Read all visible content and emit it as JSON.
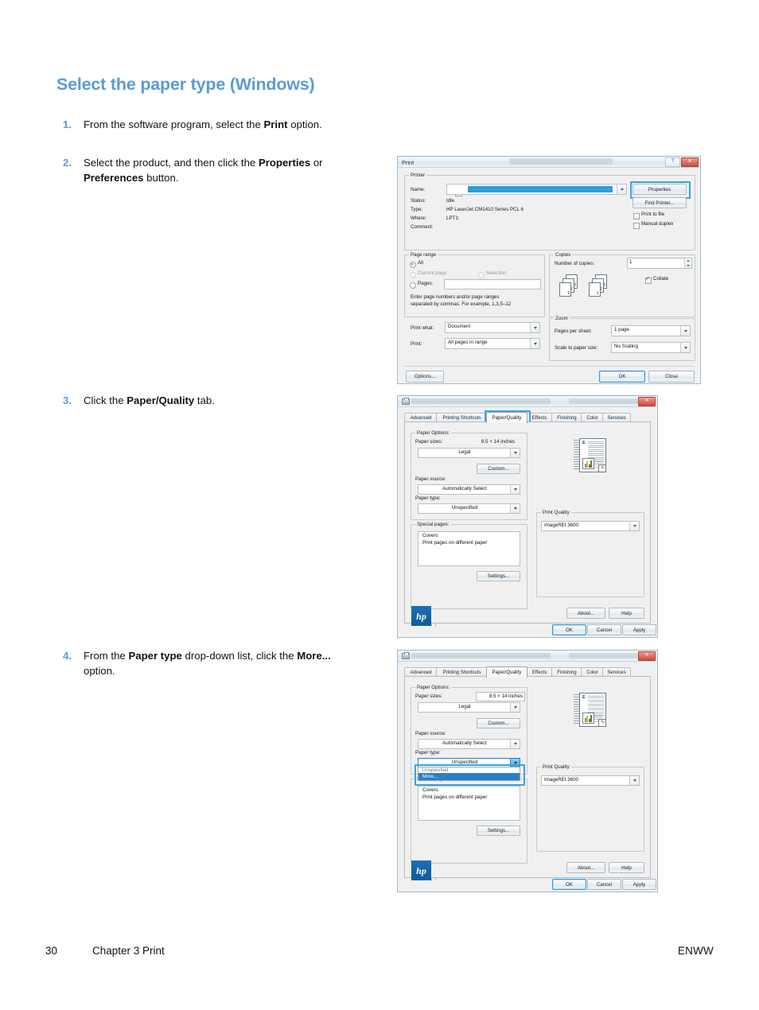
{
  "document": {
    "title": "Select the paper type (Windows)",
    "steps": [
      {
        "num": "1.",
        "text_html": "From the software program, select the <b>Print</b> option."
      },
      {
        "num": "2.",
        "text_html": "Select the product, and then click the <b>Properties</b> or <b>Preferences</b> button."
      },
      {
        "num": "3.",
        "text_html": "Click the <b>Paper/Quality</b> tab."
      },
      {
        "num": "4.",
        "text_html": "From the <b>Paper type</b> drop-down list, click the <b>More...</b> option."
      }
    ],
    "footer": {
      "page_number": "30",
      "chapter": "Chapter 3   Print",
      "right": "ENWW"
    },
    "accent_color": "#5b9bd5"
  },
  "print_dialog": {
    "title": "Print",
    "window_buttons": {
      "help": "?",
      "close": "✕"
    },
    "printer_group": {
      "label": "Printer",
      "name_label": "Name:",
      "name_value": "",
      "status_label": "Status:",
      "status_value": "Idle",
      "type_label": "Type:",
      "type_value": "HP LaserJet CM1410 Series PCL 6",
      "where_label": "Where:",
      "where_value": "LPT1:",
      "comment_label": "Comment:",
      "comment_value": "",
      "properties_button": "Properties",
      "find_printer_button": "Find Printer...",
      "print_to_file": {
        "label": "Print to file",
        "checked": false
      },
      "manual_duplex": {
        "label": "Manual duplex",
        "checked": false
      }
    },
    "page_range_group": {
      "label": "Page range",
      "all": {
        "label": "All",
        "selected": true
      },
      "current_page": {
        "label": "Current page",
        "selected": false,
        "disabled": true
      },
      "selection": {
        "label": "Selection",
        "selected": false,
        "disabled": true
      },
      "pages": {
        "label": "Pages:",
        "selected": false,
        "value": ""
      },
      "hint_line1": "Enter page numbers and/or page ranges",
      "hint_line2": "separated by commas.  For example, 1,3,5–12"
    },
    "print_what_label": "Print what:",
    "print_what_value": "Document",
    "print_label": "Print:",
    "print_value": "All pages in range",
    "copies_group": {
      "label": "Copies",
      "number_label": "Number of copies:",
      "number_value": "1",
      "collate": {
        "label": "Collate",
        "checked": true
      },
      "stack_numbers": [
        "1",
        "2",
        "3"
      ]
    },
    "zoom_group": {
      "label": "Zoom",
      "pages_per_sheet_label": "Pages per sheet:",
      "pages_per_sheet_value": "1 page",
      "scale_label": "Scale to paper size:",
      "scale_value": "No Scaling"
    },
    "buttons": {
      "options": "Options...",
      "ok": "OK",
      "close": "Close"
    }
  },
  "properties_dialog": {
    "title": "",
    "close_button": "✕",
    "tabs": [
      {
        "label": "Advanced",
        "active": false
      },
      {
        "label": "Printing Shortcuts",
        "active": false
      },
      {
        "label": "Paper/Quality",
        "active": true
      },
      {
        "label": "Effects",
        "active": false
      },
      {
        "label": "Finishing",
        "active": false
      },
      {
        "label": "Color",
        "active": false
      },
      {
        "label": "Services",
        "active": false
      }
    ],
    "paper_options": {
      "label": "Paper Options:",
      "paper_sizes_label": "Paper sizes:",
      "paper_dimensions": "8.5 × 14 inches",
      "paper_size_value": "Legal",
      "custom_button": "Custom...",
      "paper_source_label": "Paper source:",
      "paper_source_value": "Automatically Select",
      "paper_type_label": "Paper type:",
      "paper_type_value": "Unspecified"
    },
    "special_pages": {
      "label": "Special pages:",
      "items": [
        "Covers",
        "Print pages on different paper"
      ],
      "settings_button": "Settings..."
    },
    "print_quality": {
      "label": "Print Quality",
      "value": "ImageREt 3600"
    },
    "preview": {
      "letter": "E"
    },
    "logo": {
      "brand": "hp",
      "tagline": "i n v e n t"
    },
    "buttons": {
      "about": "About...",
      "help": "Help",
      "ok": "OK",
      "cancel": "Cancel",
      "apply": "Apply"
    }
  },
  "properties_dialog_open": {
    "dropdown_open": true,
    "dropdown_items": [
      {
        "label": "Unspecified",
        "highlighted": false
      },
      {
        "label": "More...",
        "highlighted": true
      }
    ],
    "highlight_color": "#2a7fc9"
  }
}
